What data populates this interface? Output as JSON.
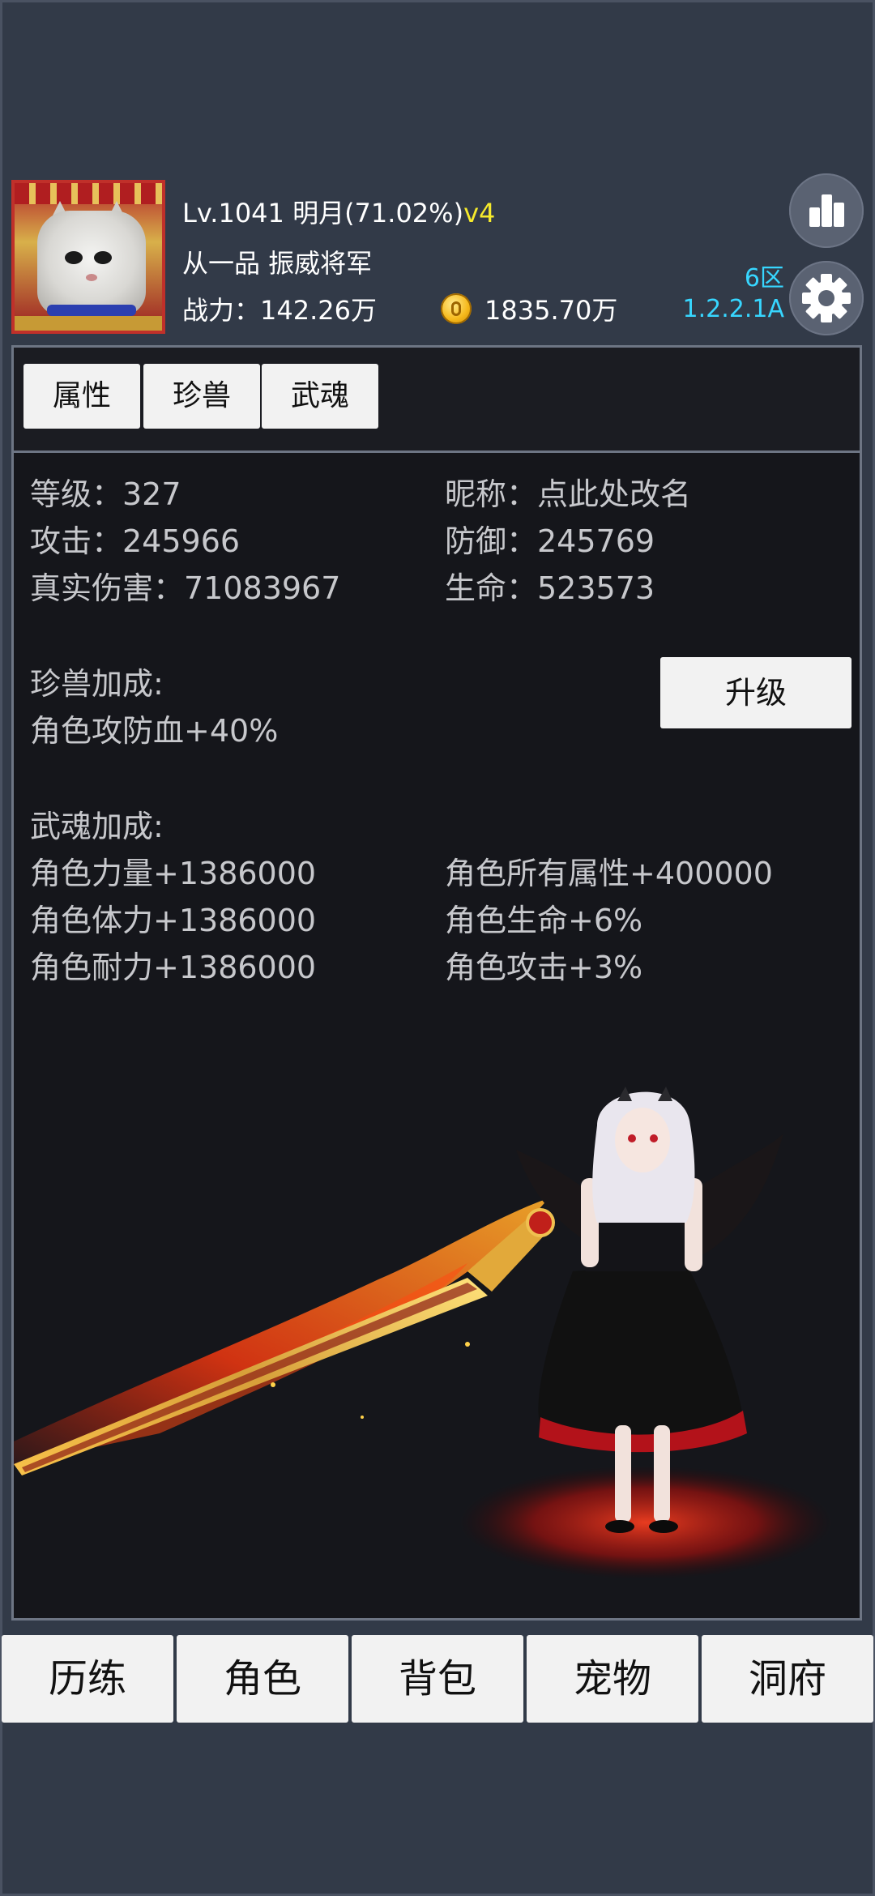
{
  "header": {
    "level_name": "Lv.1041 明月(71.02%)",
    "vip": "v4",
    "rank_title": "从一品 振威将军",
    "power": "战力：142.26万",
    "gold": "1835.70万",
    "server_zone": "6区",
    "version": "1.2.2.1A"
  },
  "tabs": [
    "属性",
    "珍兽",
    "武魂"
  ],
  "stats": {
    "level": "等级：327",
    "nickname": "昵称：点此处改名",
    "attack": "攻击：245966",
    "defense": "防御：245769",
    "true_damage": "真实伤害：71083967",
    "hp": "生命：523573"
  },
  "pet_bonus": {
    "title": "珍兽加成:",
    "value": "角色攻防血+40%",
    "upgrade_label": "升级"
  },
  "soul_bonus": {
    "title": "武魂加成:",
    "left": [
      "角色力量+1386000",
      "角色体力+1386000",
      "角色耐力+1386000"
    ],
    "right": [
      "角色所有属性+400000",
      "角色生命+6%",
      "角色攻击+3%"
    ]
  },
  "bottom_nav": [
    "历练",
    "角色",
    "背包",
    "宠物",
    "洞府"
  ],
  "icons": {
    "rank": "bar-chart-icon",
    "settings": "gear-icon",
    "coin": "gold-coin-icon"
  },
  "colors": {
    "vip": "#f6ea2c",
    "server": "#37d6ff",
    "background": "#323a48",
    "panel": "#15161b"
  }
}
